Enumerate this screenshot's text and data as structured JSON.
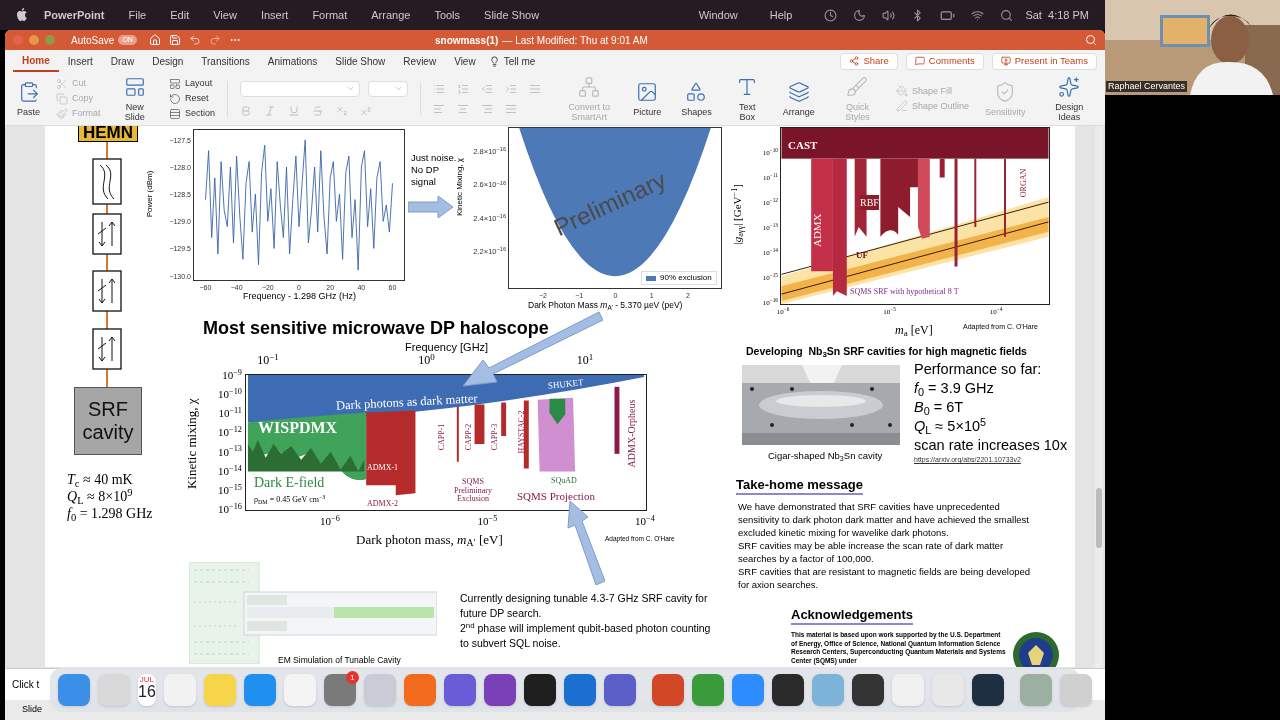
{
  "menu_bar": {
    "app": "PowerPoint",
    "menus": [
      "File",
      "Edit",
      "View",
      "Insert",
      "Format",
      "Arrange",
      "Tools",
      "Slide Show"
    ],
    "right_menus": [
      "Window",
      "Help"
    ],
    "clock": "Sat  4:18 PM"
  },
  "video": {
    "name": "Raphael Cervantes"
  },
  "window": {
    "autosave_label": "AutoSave",
    "autosave_state": "ON",
    "autosave_on": true,
    "title": "snowmass(1)",
    "modified": "— Last Modified: Thu at 9:01 AM"
  },
  "tabs": [
    {
      "label": "Home",
      "selected": true
    },
    {
      "label": "Insert",
      "selected": false
    },
    {
      "label": "Draw",
      "selected": false
    },
    {
      "label": "Design",
      "selected": false
    },
    {
      "label": "Transitions",
      "selected": false
    },
    {
      "label": "Animations",
      "selected": false
    },
    {
      "label": "Slide Show",
      "selected": false
    },
    {
      "label": "Review",
      "selected": false
    },
    {
      "label": "View",
      "selected": false
    }
  ],
  "tell_me": "Tell me",
  "actions": [
    "Share",
    "Comments",
    "Present in Teams"
  ],
  "ribbon": [
    {
      "kind": "large",
      "items": [
        {
          "label": "Paste",
          "disabled": false
        }
      ]
    },
    {
      "kind": "stack",
      "items": [
        {
          "label": "Cut",
          "disabled": true
        },
        {
          "label": "Copy",
          "disabled": true
        },
        {
          "label": "Format",
          "disabled": true
        }
      ]
    },
    {
      "kind": "large",
      "items": [
        {
          "label": "New Slide",
          "disabled": false
        }
      ]
    },
    {
      "kind": "stack",
      "items": [
        {
          "label": "Layout",
          "disabled": false
        },
        {
          "label": "Reset",
          "disabled": false
        },
        {
          "label": "Section",
          "disabled": false
        }
      ]
    },
    {
      "kind": "font"
    },
    {
      "kind": "paragraph"
    },
    {
      "kind": "large",
      "items": [
        {
          "label": "Convert to SmartArt",
          "disabled": true
        }
      ]
    },
    {
      "kind": "large",
      "items": [
        {
          "label": "Picture",
          "disabled": false
        }
      ]
    },
    {
      "kind": "large",
      "items": [
        {
          "label": "Shapes",
          "disabled": false
        }
      ]
    },
    {
      "kind": "large",
      "items": [
        {
          "label": "Text Box",
          "disabled": false
        }
      ]
    },
    {
      "kind": "large",
      "items": [
        {
          "label": "Arrange",
          "disabled": false
        }
      ]
    },
    {
      "kind": "large",
      "items": [
        {
          "label": "Quick Styles",
          "disabled": true
        }
      ]
    },
    {
      "kind": "stack",
      "items": [
        {
          "label": "Shape Fill",
          "disabled": true
        },
        {
          "label": "Shape Outline",
          "disabled": true
        }
      ]
    },
    {
      "kind": "large",
      "items": [
        {
          "label": "Sensitivity",
          "disabled": true
        }
      ]
    },
    {
      "kind": "large",
      "items": [
        {
          "label": "Design Ideas",
          "disabled": false
        }
      ]
    }
  ],
  "slide": {
    "signal_chain": {
      "amp_label": "HEMN",
      "cavity_label": "SRF cavity",
      "params": [
        "*T*$_{c}$ ≈ 40 mK",
        "*Q*$_{L}$ ≈ 8×10$^{9}$",
        "*f*$_{0}$ = 1.298 GHz"
      ]
    },
    "noise_plot": {
      "chart_data": {
        "type": "line",
        "xlabel": "Frequency - 1.298 GHz (Hz)",
        "ylabel": "Power (dBm)",
        "xlim": [
          -68,
          68
        ],
        "ylim": [
          -130.1,
          -127.3
        ],
        "xticks": [
          {
            "value": -60,
            "label": "−60"
          },
          {
            "value": -40,
            "label": "−40"
          },
          {
            "value": -20,
            "label": "−20"
          },
          {
            "value": 0,
            "label": "0"
          },
          {
            "value": 20,
            "label": "20"
          },
          {
            "value": 40,
            "label": "40"
          },
          {
            "value": 60,
            "label": "60"
          }
        ],
        "yticks": [
          {
            "value": -127.5,
            "label": "−127.5"
          },
          {
            "value": -128.0,
            "label": "−128.0"
          },
          {
            "value": -128.5,
            "label": "−128.5"
          },
          {
            "value": -129.0,
            "label": "−129.0"
          },
          {
            "value": -129.5,
            "label": "−129.5"
          },
          {
            "value": -130.0,
            "label": "−130.0"
          }
        ],
        "x": [
          -60,
          -58,
          -56,
          -54,
          -52,
          -50,
          -48,
          -46,
          -44,
          -42,
          -40,
          -38,
          -36,
          -34,
          -32,
          -30,
          -28,
          -26,
          -24,
          -22,
          -20,
          -18,
          -16,
          -14,
          -12,
          -10,
          -8,
          -6,
          -4,
          -2,
          0,
          2,
          4,
          6,
          8,
          10,
          12,
          14,
          16,
          18,
          20,
          22,
          24,
          26,
          28,
          30,
          32,
          34,
          36,
          38,
          40,
          42,
          44,
          46,
          48,
          50,
          52,
          54,
          56,
          58,
          60
        ],
        "series": [
          {
            "color": "#3a64a8",
            "values": [
              -128.6,
              -127.7,
              -129.3,
              -128.2,
              -129.6,
              -127.9,
              -128.8,
              -129.1,
              -128.0,
              -129.4,
              -127.8,
              -128.9,
              -129.7,
              -128.3,
              -127.9,
              -129.2,
              -128.5,
              -129.8,
              -128.1,
              -127.6,
              -129.0,
              -128.4,
              -129.5,
              -127.9,
              -128.7,
              -129.3,
              -128.0,
              -129.6,
              -128.6,
              -127.8,
              -129.1,
              -128.3,
              -127.5,
              -129.4,
              -128.8,
              -128.0,
              -129.2,
              -127.7,
              -128.9,
              -129.6,
              -128.2,
              -127.9,
              -129.0,
              -128.5,
              -129.7,
              -128.1,
              -127.8,
              -129.3,
              -128.6,
              -129.9,
              -128.0,
              -127.7,
              -129.1,
              -128.4,
              -129.5,
              -128.2,
              -127.9,
              -129.0,
              -128.7,
              -129.2,
              -128.3
            ]
          }
        ]
      }
    },
    "noise_note": "Just noise. No DP signal",
    "exclusion_plot": {
      "ylabel": "Kinetic Mixing, χ",
      "xlabel": "Dark Photon Mass *m*$_{A′}$ - 5.370 µeV (peV)",
      "yticks": [
        "2.8×10$^{−16}$",
        "2.6×10$^{−16}$",
        "2.4×10$^{−16}$",
        "2.2×10$^{−16}$"
      ],
      "xticks": [
        "−2",
        "−1",
        "0",
        "1",
        "2"
      ],
      "legend": "90% exclusion",
      "watermark": "Preliminary"
    },
    "headline": "Most sensitive microwave DP haloscope",
    "dp_plot": {
      "top_axis_label": "Frequency [GHz]",
      "top_ticks": [
        "10$^{−1}$",
        "10$^{0}$",
        "10$^{1}$"
      ],
      "yticks": [
        "10$^{−9}$",
        "10$^{−10}$",
        "10$^{−11}$",
        "10$^{−12}$",
        "10$^{−13}$",
        "10$^{−14}$",
        "10$^{−15}$",
        "10$^{−16}$"
      ],
      "xticks": [
        "10$^{−6}$",
        "10$^{−5}$",
        "10$^{−4}$"
      ],
      "xlabel": "Dark photon mass, *m*$_{A′}$ [eV]",
      "ylabel": "Kinetic mixing, χ",
      "labels": [
        "Dark photons as dark matter",
        "SHUKET",
        "WISPDMX",
        "Dark E-field",
        "ρ$_{DM}$ = 0.45 GeV cm$^{−3}$",
        "ADMX-1",
        "ADMX-2",
        "CAPP-1",
        "CAPP-2",
        "CAPP-3",
        "HAYSTAC-2",
        "SQMS Preliminary Exclusion",
        "SQuAD",
        "SQMS Projection",
        "ADMX-Orpheus"
      ],
      "credit": "Adapted from C. O'Hare"
    },
    "em_sim": {
      "caption": "EM Simulation of Tunable Cavity"
    },
    "future_note": [
      "Currently designing tunable 4.3-7 GHz SRF cavity for future DP search.",
      "2$^{nd}$ phase will implement qubit-based photon counting to subvert SQL noise."
    ],
    "axion_plot": {
      "ylabel": "|*g*$_{aγγ}$| [GeV$^{−1}$]",
      "yticks": [
        "10$^{−10}$",
        "10$^{−11}$",
        "10$^{−12}$",
        "10$^{−13}$",
        "10$^{−14}$",
        "10$^{−15}$",
        "10$^{−16}$"
      ],
      "xticks": [
        "10$^{−6}$",
        "10$^{−5}$",
        "10$^{−4}$"
      ],
      "xlabel": "*m*$_{a}$ [eV]",
      "labels": [
        "CAST",
        "ADMX",
        "RBF",
        "UF",
        "ORGAN",
        "SQMS SRF with hypothetical 8 T"
      ],
      "credit": "Adapted from C. O'Hare"
    },
    "nb3sn": {
      "heading": "Developing  Nb$_{3}$Sn SRF cavities for high magnetic fields",
      "caption": "Cigar-shaped Nb$_{3}$Sn cavity",
      "performance": [
        "Performance so far:",
        "*f*$_{0}$ = 3.9 GHz",
        "*B*$_{0}$ = 6T",
        "*Q*$_{L}$ ≈ 5×10$^{5}$",
        "scan rate increases 10x"
      ],
      "link": "https://arxiv.org/abs/2201.10733v2"
    },
    "take_home": {
      "heading": "Take-home message",
      "paragraphs": [
        "We have demonstrated that SRF cavities have unprecedented sensitivity to dark photon dark matter and have achieved the smallest excluded kinetic mixing for wavelike dark photons.",
        "SRF cavities may be able increase the scan rate of dark matter searches by a factor of 100,000.",
        "SRF cavities that are resistant to magnetic fields are being developed for axion searches."
      ]
    },
    "acknowledgements": {
      "heading": "Acknowledgements",
      "text": "This material is based upon work supported by the U.S. Department of Energy, Office of Science, National Quantum Information Science Research Centers, Superconducting Quantum Materials and Systems Center (SQMS) under"
    }
  },
  "notes": "Click t",
  "status_bar": "Slide",
  "dock": {
    "calendar_month": "JUL",
    "calendar_day": "16",
    "badge": "1"
  }
}
